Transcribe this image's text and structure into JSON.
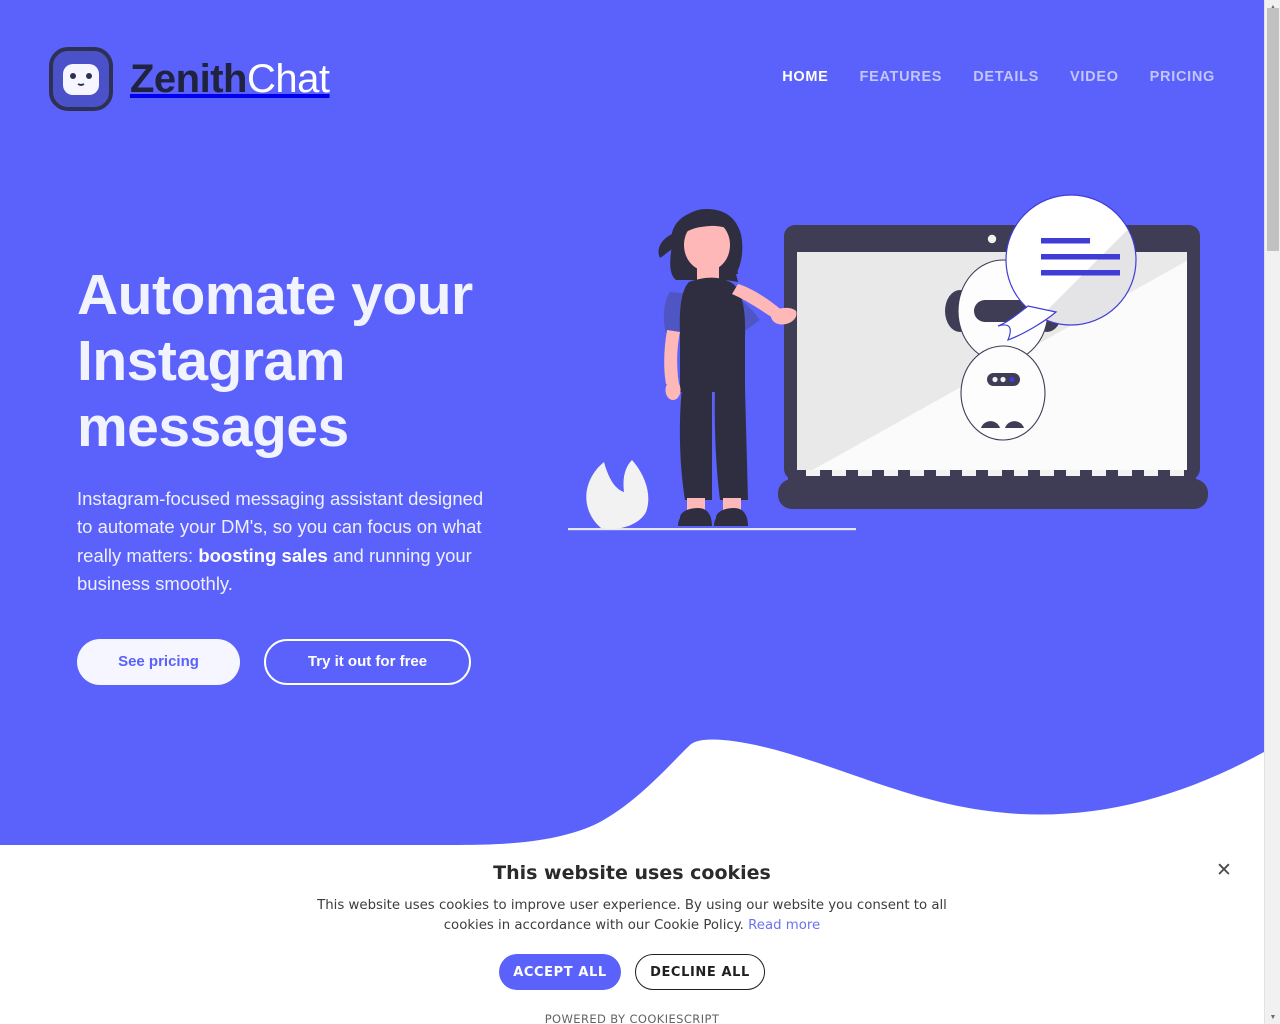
{
  "brand": {
    "name_part1": "Zenith",
    "name_part2": "Chat",
    "logo_icon": "robot-face-icon"
  },
  "nav": {
    "items": [
      {
        "label": "HOME",
        "active": true
      },
      {
        "label": "FEATURES",
        "active": false
      },
      {
        "label": "DETAILS",
        "active": false
      },
      {
        "label": "VIDEO",
        "active": false
      },
      {
        "label": "PRICING",
        "active": false
      }
    ]
  },
  "hero": {
    "title": "Automate your Instagram messages",
    "subtitle_part1": "Instagram-focused messaging assistant designed to automate your DM's, so you can focus on what really matters: ",
    "subtitle_bold": "boosting sales",
    "subtitle_part2": " and running your business smoothly.",
    "primary_button": "See pricing",
    "secondary_button": "Try it out for free",
    "background_color": "#5b61fb"
  },
  "illustration": {
    "alt": "Woman standing beside a large laptop showing a chat robot with a speech bubble",
    "colors": {
      "dark": "#3f3d56",
      "darker": "#2f2e41",
      "skin": "#ffb8b8",
      "screen": "#f2f2f2",
      "accent_blue": "#3f3dd6",
      "shirt_blue": "#4f56c4",
      "white": "#ffffff"
    }
  },
  "cookie_banner": {
    "title": "This website uses cookies",
    "description": "This website uses cookies to improve user experience. By using our website you consent to all cookies in accordance with our Cookie Policy.",
    "read_more": "Read more",
    "accept_label": "ACCEPT ALL",
    "decline_label": "DECLINE ALL",
    "powered_by": "POWERED BY COOKIESCRIPT",
    "close_icon": "✕",
    "accent_color": "#5b61fb"
  },
  "scrollbar": {
    "up_arrow": "▲",
    "down_arrow": "▼"
  }
}
